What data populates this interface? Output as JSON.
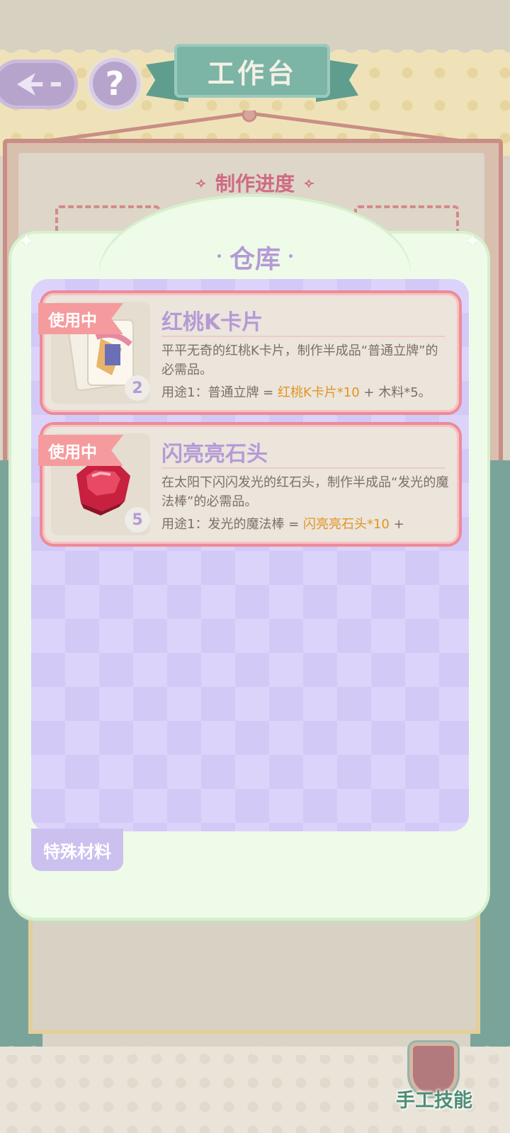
{
  "header": {
    "title": "工作台",
    "help_label": "?"
  },
  "board": {
    "progress_title": "制作进度"
  },
  "warehouse": {
    "title": "仓库",
    "items": [
      {
        "badge": "使用中",
        "name": "红桃K卡片",
        "count": "2",
        "description": "平平无奇的红桃K卡片，制作半成品“普通立牌”的必需品。",
        "usage_prefix": "用途1：普通立牌 = ",
        "usage_highlight": "红桃K卡片*10",
        "usage_suffix": " + 木料*5。",
        "icon": "playing-card-icon"
      },
      {
        "badge": "使用中",
        "name": "闪亮亮石头",
        "count": "5",
        "description": "在太阳下闪闪发光的红石头，制作半成品“发光的魔法棒”的必需品。",
        "usage_prefix": "用途1：发光的魔法棒 = ",
        "usage_highlight": "闪亮亮石头*10",
        "usage_suffix": " +",
        "icon": "red-gem-icon"
      }
    ],
    "tab_label": "特殊材料"
  },
  "footer": {
    "skill_label": "手工技能"
  },
  "colors": {
    "accent_purple": "#b59ad6",
    "card_border": "#ee8a96",
    "highlight": "#e39422",
    "teal": "#7cb4a5"
  }
}
